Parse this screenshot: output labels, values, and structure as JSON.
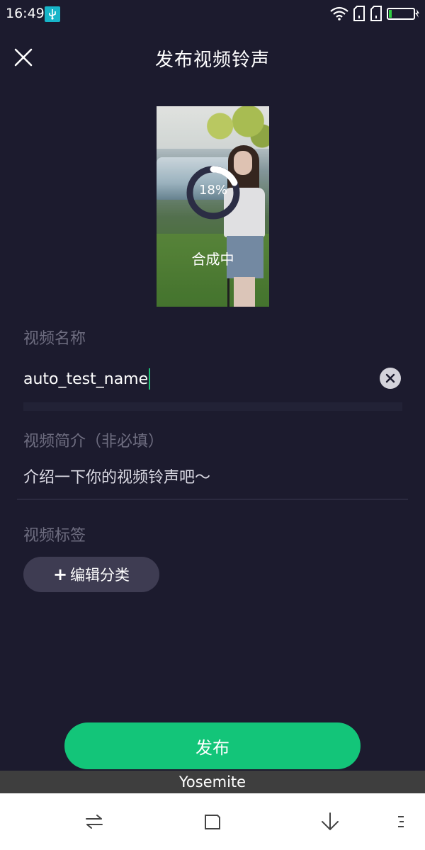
{
  "status_bar": {
    "time": "16:49",
    "icons": [
      "usb-icon",
      "wifi-icon",
      "sim1-icon",
      "sim2-icon",
      "battery-icon"
    ]
  },
  "header": {
    "title": "发布视频铃声",
    "close_icon": "close-icon"
  },
  "preview": {
    "progress_text": "18%",
    "progress_value": 0.18,
    "status_text": "合成中"
  },
  "form": {
    "name_label": "视频名称",
    "name_value": "auto_test_name",
    "clear_icon": "clear-icon",
    "desc_label": "视频简介（非必填）",
    "desc_placeholder": "介绍一下你的视频铃声吧～",
    "tag_label": "视频标签",
    "tag_button": "编辑分类",
    "tag_plus": "+"
  },
  "publish_button": "发布",
  "yosemite_label": "Yosemite",
  "nav_bar": {
    "icons": [
      "switch-icon",
      "home-icon",
      "back-icon",
      "menu-icon"
    ]
  },
  "colors": {
    "background": "#1c1b2e",
    "accent": "#13c579",
    "label": "#6e6d80",
    "tag_button": "#3e3c52"
  }
}
